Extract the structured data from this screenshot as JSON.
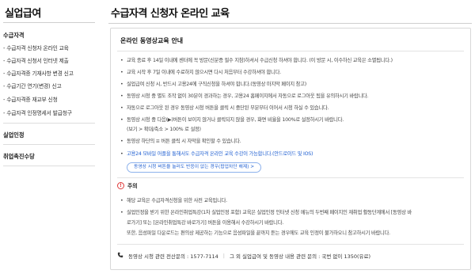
{
  "sidebar": {
    "title": "실업급여",
    "sections": [
      {
        "label": "수급자격",
        "items": [
          "- 수급자격 신청자 온라인 교육",
          "- 수급자격 신청서 인터넷 제출",
          "- 수급자격증 기재사항 변경 신고",
          "- 수급기간 연기(변경) 신고",
          "- 수급자격증 재교부 신청",
          "- 수급자격 인정명세서 발급청구"
        ]
      },
      {
        "label": "실업인정",
        "items": []
      },
      {
        "label": "취업촉진수당",
        "items": []
      }
    ]
  },
  "main": {
    "title": "수급자격 신청자 온라인 교육",
    "panel_heading": "온라인 동영상교육 안내",
    "bullets": [
      "교육 종료 후 14일 이내에 센터에 꼭 방문(신분증 필수 지참)하셔서 수급신청 하셔야 합니다. (이 방문 시, 이수하신 교육은 소멸됩니다.)",
      "교육 시작 후 7일 이내에 수료하지 않으시면 다시 처음부터 수강하셔야 합니다.",
      "실업급여 신청 시, 반드시 고용24에 구직신청을 하셔야 합니다.(동영상 마지막 페이지 참고)",
      "동영상 시청 중 별도 조작 없이 30분이 경과하는 경우, 고용24 홈페이지에서 자동으로 로그아웃 됨을 유의하시기 바랍니다.",
      "자동으로 로그아웃 된 경우 동영상 시청 버튼을 클릭 시 중단된 부분부터 이어서 시청 하실 수 있습니다.",
      "동영상 시청 중 다음(▶)버튼이 보이지 않거나 클릭되지 않을 경우, 화면 비율을 100%로 설정하시기 바랍니다.",
      "(보기 > 확대/축소 > 100% 로 설정)",
      "동영상 하단의 ≡ 버튼 클릭 시 자막을 확인할 수 있습니다.",
      "고용24 모바일 어플을 통해서도 수급자격 온라인 교육 수강이 가능합니다.(안드로이드 및 IOS)"
    ],
    "pill_button": "동영상 시청 버튼을 눌러도 반응이 없는 경우(팝업차단 해제) >",
    "notice_icon": "!",
    "notice_label": "주의",
    "notices": [
      "해당 교육은 수급자격신청을 위한 사전 교육입니다.",
      "실업인정을 받기 위한 온라인취업특강(1차 실업인정 포함) 교육은 실업인정 인터넷 신청 메뉴의 두번째 페이지인 재취업 활동단계에서 [동영상 바",
      "로가기] 또는 [온라인취업특강 바로가기] 버튼을 이용해서 수강하시기 바랍니다.",
      "또한, 음성파일 다운로드는 편의상 제공하는 기능으로 음성파일을 끝까지 듣는 경우에도 교육 인정이 불가하오니 참고하시기 바랍니다."
    ],
    "footer_phone_icon": "phone-icon",
    "footer_left": "동영상 시청 관련 전산문의 : 1577-7114",
    "footer_right": "그 외 실업급여 및 동영상 내용 관련 문의 : 국번 없이 1350(유료)"
  }
}
